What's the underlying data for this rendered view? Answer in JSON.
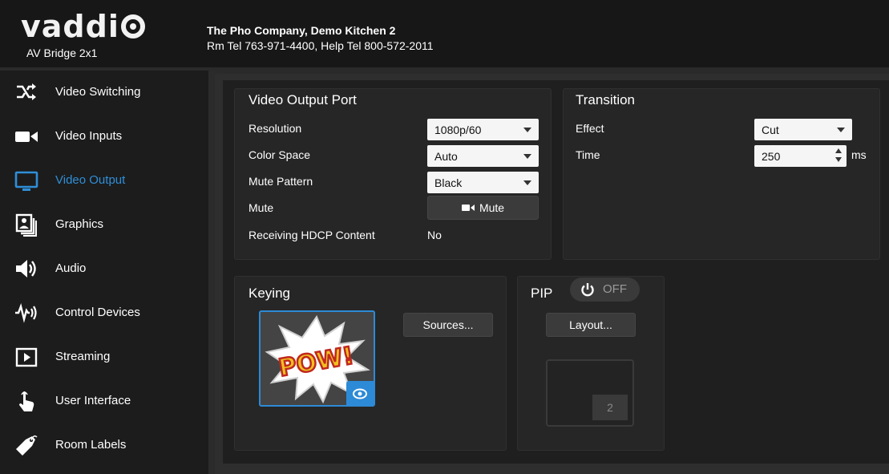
{
  "header": {
    "brand": "vadd",
    "brand_tail": "i",
    "product": "AV Bridge 2x1",
    "location_line1": "The Pho Company, Demo Kitchen 2",
    "location_line2": "Rm Tel 763-971-4400, Help Tel 800-572-2011"
  },
  "sidebar": {
    "items": [
      {
        "label": "Video Switching",
        "icon": "shuffle-icon",
        "active": false
      },
      {
        "label": "Video Inputs",
        "icon": "video-camera-icon",
        "active": false
      },
      {
        "label": "Video Output",
        "icon": "monitor-icon",
        "active": true
      },
      {
        "label": "Graphics",
        "icon": "photo-stack-icon",
        "active": false
      },
      {
        "label": "Audio",
        "icon": "speaker-icon",
        "active": false
      },
      {
        "label": "Control Devices",
        "icon": "signal-wave-icon",
        "active": false
      },
      {
        "label": "Streaming",
        "icon": "play-icon",
        "active": false
      },
      {
        "label": "User Interface",
        "icon": "hand-pointer-icon",
        "active": false
      },
      {
        "label": "Room Labels",
        "icon": "tag-icon",
        "active": false
      }
    ],
    "active_color": "#2f8fd8"
  },
  "video_output_port": {
    "title": "Video Output Port",
    "resolution_label": "Resolution",
    "resolution_value": "1080p/60",
    "color_space_label": "Color Space",
    "color_space_value": "Auto",
    "mute_pattern_label": "Mute Pattern",
    "mute_pattern_value": "Black",
    "mute_label": "Mute",
    "mute_button": "Mute",
    "hdcp_label": "Receiving HDCP Content",
    "hdcp_value": "No"
  },
  "transition": {
    "title": "Transition",
    "effect_label": "Effect",
    "effect_value": "Cut",
    "time_label": "Time",
    "time_value": "250",
    "time_unit": "ms"
  },
  "keying": {
    "title": "Keying",
    "sources_button": "Sources...",
    "thumbnail_text": "POW!"
  },
  "pip": {
    "title": "PIP",
    "toggle_state": "OFF",
    "layout_button": "Layout...",
    "window_number": "2"
  }
}
